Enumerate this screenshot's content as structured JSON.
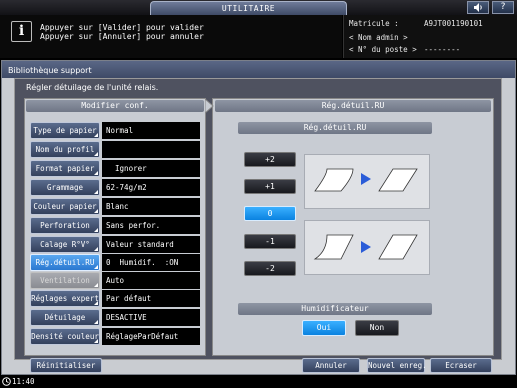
{
  "app": {
    "title": "UTILITAIRE"
  },
  "top_icons": {
    "speaker": "speaker-icon",
    "help": "?"
  },
  "message": {
    "line1": "Appuyer sur [Valider] pour valider",
    "line2": "Appuyer sur [Annuler] pour annuler"
  },
  "user_panel": {
    "matricule_label": "Matricule :",
    "matricule_value": "A9JT001190101",
    "admin_label": "< Nom admin >",
    "station_label": "< N° du poste >",
    "station_value": "--------"
  },
  "dialog": {
    "title": "Bibliothèque support",
    "subtitle": "Régler détuilage de l'unité relais."
  },
  "left_panel": {
    "header": "Modifier conf.",
    "rows": [
      {
        "label": "Type de papier",
        "value": "Normal",
        "state": "normal"
      },
      {
        "label": "Nom du profil",
        "value": "",
        "state": "normal"
      },
      {
        "label": "Format papier",
        "value": "  Ignorer",
        "state": "normal"
      },
      {
        "label": "Grammage",
        "value": "62-74g/m2",
        "state": "normal"
      },
      {
        "label": "Couleur papier",
        "value": "Blanc",
        "state": "normal"
      },
      {
        "label": "Perforation",
        "value": "Sans perfor.",
        "state": "normal"
      },
      {
        "label": "Calage R°V°",
        "value": "Valeur standard",
        "state": "normal"
      },
      {
        "label": "Rég.détuil.RU",
        "value": "0  Humidif.  :ON",
        "state": "selected"
      },
      {
        "label": "Ventilation",
        "value": "Auto",
        "state": "disabled"
      },
      {
        "label": "Réglages expert",
        "value": "Par défaut",
        "state": "normal"
      },
      {
        "label": "Détuilage",
        "value": "DESACTIVE",
        "state": "normal"
      },
      {
        "label": "Densité couleur",
        "value": "RéglageParDéfaut",
        "state": "normal"
      }
    ]
  },
  "right_panel": {
    "header": "Rég.détuil.RU",
    "subheader": "Rég.détuil.RU",
    "adjust_buttons": [
      "+2",
      "+1",
      "0",
      "-1",
      "-2"
    ],
    "selected_adjust": "0",
    "humidifier": {
      "header": "Humidificateur",
      "on_label": "Oui",
      "off_label": "Non",
      "selected": "Oui"
    }
  },
  "footer": {
    "reset": "Réinitialiser",
    "cancel": "Annuler",
    "new_save": "Nouvel enreg.",
    "overwrite": "Ecraser"
  },
  "status": {
    "time": "11:40"
  },
  "colors": {
    "accent_selected": "#2a9af0",
    "arrow": "#2a5cd8"
  }
}
